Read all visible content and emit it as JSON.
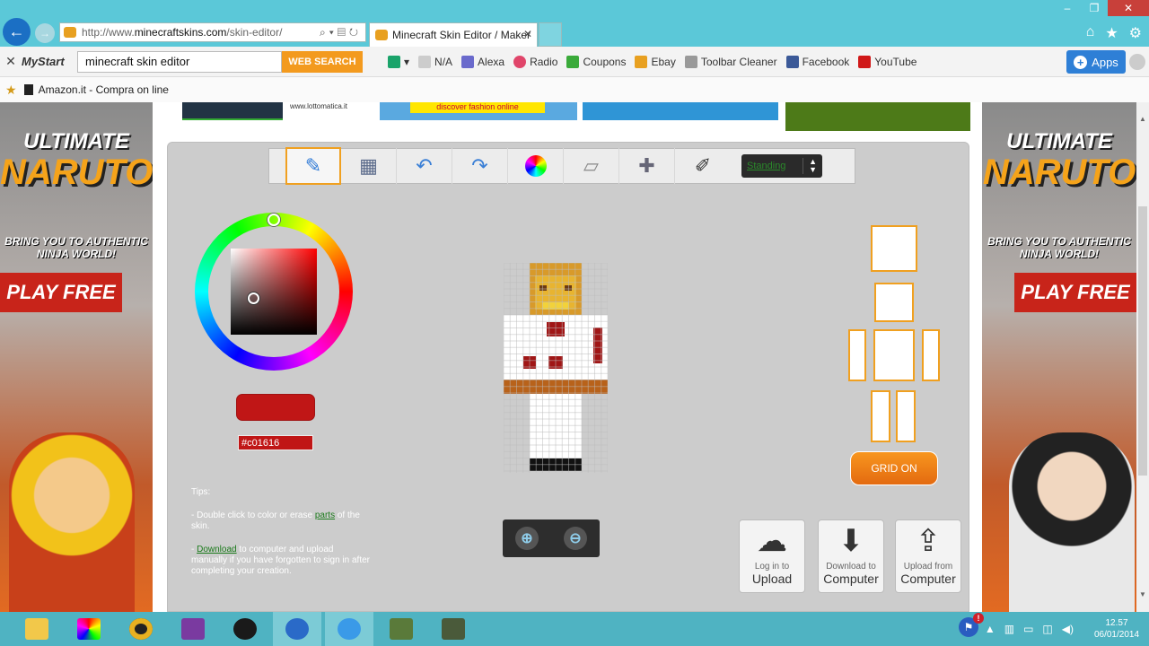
{
  "browser": {
    "url_prefix": "http://www.",
    "url_domain": "minecraftskins.com",
    "url_path": "/skin-editor/",
    "tab_title": "Minecraft Skin Editor / Maker",
    "tab_close": "✕"
  },
  "toolbar": {
    "close": "✕",
    "brand": "MyStart",
    "search_value": "minecraft skin editor",
    "search_button": "WEB SEARCH",
    "items": [
      "N/A",
      "Alexa",
      "Radio",
      "Coupons",
      "Ebay",
      "Toolbar Cleaner",
      "Facebook",
      "YouTube"
    ],
    "apps": "Apps"
  },
  "favorites": {
    "item": "Amazon.it - Compra on line"
  },
  "ads": {
    "left": {
      "logo1": "ULTIMATE",
      "logo2": "NARUTO",
      "tagline": "BRING YOU TO AUTHENTIC NINJA WORLD!",
      "cta": "PLAY FREE"
    },
    "right": {
      "logo1": "ULTIMATE",
      "logo2": "NARUTO",
      "tagline": "BRING YOU TO AUTHENTIC NINJA WORLD!",
      "cta": "PLAY FREE"
    },
    "top": {
      "lotto_text": "www.lottomatica.it",
      "fashion_text": "discover fashion online"
    }
  },
  "editor": {
    "mode": "Standing",
    "color_hex": "#c01616",
    "tips": {
      "title": "Tips:",
      "line1_pre": "- Double click to color or erase ",
      "line1_link": "parts",
      "line1_post": " of the skin.",
      "line2_pre": "- ",
      "line2_link": "Download",
      "line2_post": " to computer and upload manually if you have forgotten to sign in after completing your creation."
    },
    "grid_button": "GRID ON",
    "actions": [
      {
        "small": "Log in to",
        "big": "Upload"
      },
      {
        "small": "Download to",
        "big": "Computer"
      },
      {
        "small": "Upload from",
        "big": "Computer"
      }
    ]
  },
  "taskbar": {
    "time": "12.57",
    "date": "06/01/2014"
  },
  "colors": {
    "accent": "#f0a020",
    "selected_color": "#c01616"
  }
}
